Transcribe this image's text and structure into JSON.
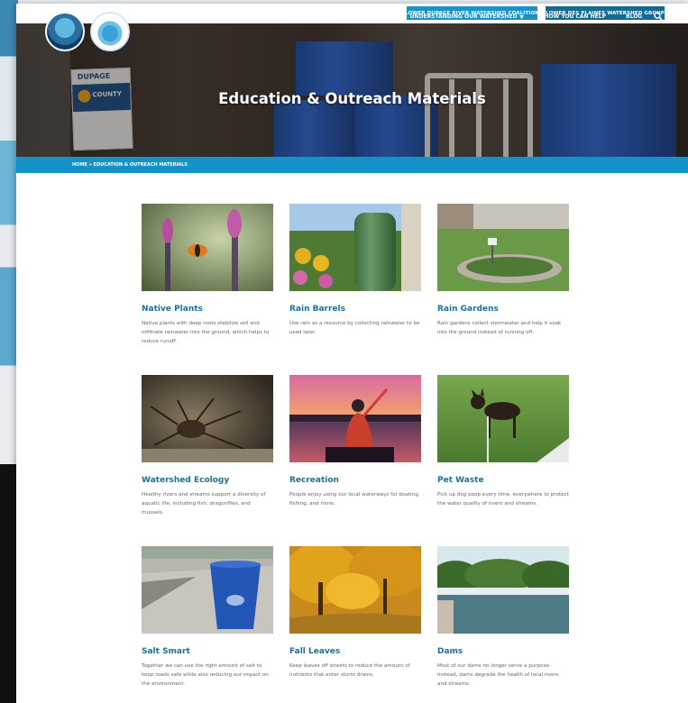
{
  "top_links": {
    "lower_dupage": "Lower DuPage River Watershed Coalition",
    "lower_des_plaines": "Lower Des Plaines Watershed Group"
  },
  "nav": {
    "about": "About Us",
    "understanding": "Understanding Our Watershed",
    "help": "How You Can Help",
    "blog": "Blog"
  },
  "hero": {
    "title": "Education & Outreach Materials",
    "brochure_line1": "DUPAGE",
    "brochure_line2": "COUNTY"
  },
  "breadcrumb": "Home » Education & Outreach Materials",
  "cards": [
    {
      "title": "Native Plants",
      "desc": "Native plants with deep roots stabilize soil and infiltrate rainwater into the ground, which helps to reduce runoff."
    },
    {
      "title": "Rain Barrels",
      "desc": "Use rain as a resource by collecting rainwater to be used later."
    },
    {
      "title": "Rain Gardens",
      "desc": "Rain gardens collect stormwater and help it soak into the ground instead of running off."
    },
    {
      "title": "Watershed Ecology",
      "desc": "Healthy rivers and streams support a diversity of aquatic life, including fish, dragonflies, and mussels."
    },
    {
      "title": "Recreation",
      "desc": "People enjoy using our local waterways for boating, fishing, and more."
    },
    {
      "title": "Pet Waste",
      "desc": "Pick up dog poop every time, everywhere to protect the water quality of rivers and streams."
    },
    {
      "title": "Salt Smart",
      "desc": "Together we can use the right amount of salt to keep roads safe while also reducing our impact on the environment."
    },
    {
      "title": "Fall Leaves",
      "desc": "Keep leaves off streets to reduce the amount of nutrients that enter storm drains."
    },
    {
      "title": "Dams",
      "desc": "Most of our dams no longer serve a purpose. Instead, dams degrade the health of local rivers and streams."
    }
  ],
  "colors": {
    "accent": "#1593c9",
    "title_blue": "#1e6f9a",
    "dark_button": "#136a92"
  },
  "icons": {
    "search": "search-icon",
    "dropdown": "chevron-down-icon"
  }
}
